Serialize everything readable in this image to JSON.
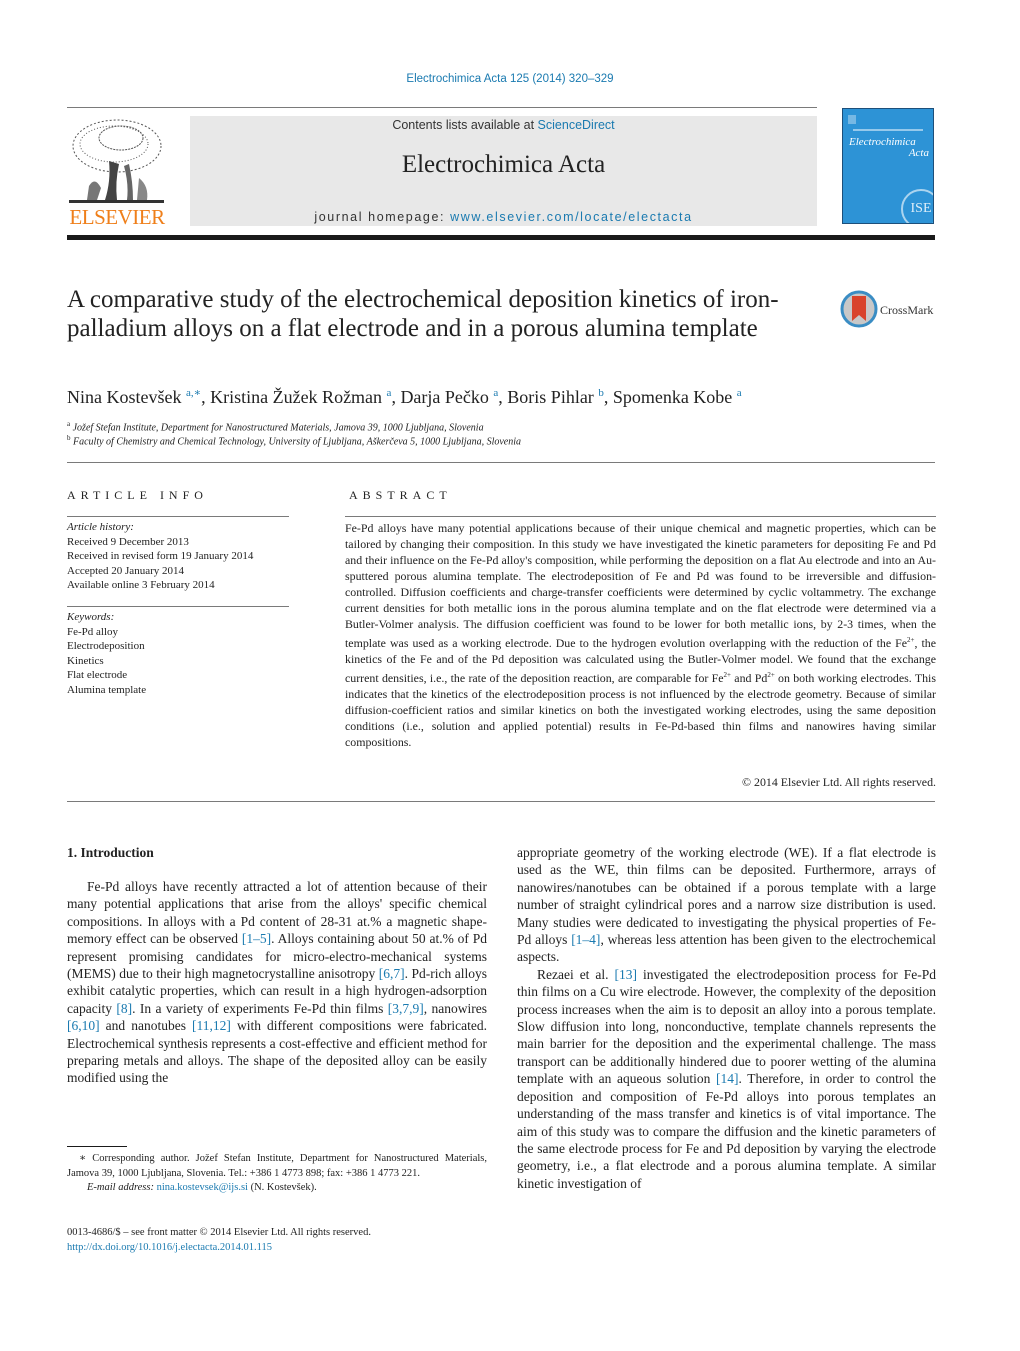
{
  "header": {
    "citation": "Electrochimica Acta 125 (2014) 320–329",
    "contents_prefix": "Contents lists available at ",
    "contents_link": "ScienceDirect",
    "journal_name": "Electrochimica Acta",
    "homepage_prefix": "journal homepage: ",
    "homepage_url": "www.elsevier.com/locate/electacta",
    "publisher_logo_text": "ELSEVIER",
    "cover_title_line1": "Electrochimica",
    "cover_title_line2": "Acta",
    "cover_badge": "ISE",
    "colors": {
      "link": "#1a7ab0",
      "elsevier_orange": "#ef7f1a",
      "cover_blue": "#2d93d6",
      "header_bg": "#e8e8e8"
    }
  },
  "article": {
    "title": "A comparative study of the electrochemical deposition kinetics of iron-palladium alloys on a flat electrode and in a porous alumina template",
    "crossmark_label": "CrossMark",
    "authors": [
      {
        "name": "Nina Kostevšek",
        "sup": "a,∗"
      },
      {
        "name": "Kristina Žužek Rožman",
        "sup": "a"
      },
      {
        "name": "Darja Pečko",
        "sup": "a"
      },
      {
        "name": "Boris Pihlar",
        "sup": "b"
      },
      {
        "name": "Spomenka Kobe",
        "sup": "a"
      }
    ],
    "affiliations": [
      {
        "sup": "a",
        "text": "Jožef Stefan Institute, Department for Nanostructured Materials, Jamova 39, 1000 Ljubljana, Slovenia"
      },
      {
        "sup": "b",
        "text": "Faculty of Chemistry and Chemical Technology, University of Ljubljana, Aškerčeva 5, 1000 Ljubljana, Slovenia"
      }
    ]
  },
  "article_info": {
    "heading": "ARTICLE INFO",
    "history_label": "Article history:",
    "history": [
      "Received 9 December 2013",
      "Received in revised form 19 January 2014",
      "Accepted 20 January 2014",
      "Available online 3 February 2014"
    ],
    "keywords_label": "Keywords:",
    "keywords": [
      "Fe-Pd alloy",
      "Electrodeposition",
      "Kinetics",
      "Flat electrode",
      "Alumina template"
    ]
  },
  "abstract": {
    "heading": "ABSTRACT",
    "part1": "Fe-Pd alloys have many potential applications because of their unique chemical and magnetic properties, which can be tailored by changing their composition. In this study we have investigated the kinetic parameters for depositing Fe and Pd and their influence on the Fe-Pd alloy's composition, while performing the deposition on a flat Au electrode and into an Au-sputtered porous alumina template. The electrodeposition of Fe and Pd was found to be irreversible and diffusion-controlled. Diffusion coefficients and charge-transfer coefficients were determined by cyclic voltammetry. The exchange current densities for both metallic ions in the porous alumina template and on the flat electrode were determined via a Butler-Volmer analysis. The diffusion coefficient was found to be lower for both metallic ions, by 2-3 times, when the template was used as a working electrode. Due to the hydrogen evolution overlapping with the reduction of the Fe",
    "part2": ", the kinetics of the Fe and of the Pd deposition was calculated using the Butler-Volmer model. We found that the exchange current densities, i.e., the rate of the deposition reaction, are comparable for Fe",
    "part3": " and Pd",
    "part4": " on both working electrodes. This indicates that the kinetics of the electrodeposition process is not influenced by the electrode geometry. Because of similar diffusion-coefficient ratios and similar kinetics on both the investigated working electrodes, using the same deposition conditions (i.e., solution and applied potential) results in Fe-Pd-based thin films and nanowires having similar compositions.",
    "charge": "2+",
    "copyright": "© 2014 Elsevier Ltd. All rights reserved."
  },
  "intro": {
    "heading": "1.  Introduction",
    "left": {
      "t1": "Fe-Pd alloys have recently attracted a lot of attention because of their many potential applications that arise from the alloys' specific chemical compositions. In alloys with a Pd content of 28-31 at.% a magnetic shape-memory effect can be observed ",
      "r1": "[1–5]",
      "t2": ". Alloys containing about 50 at.% of Pd represent promising candidates for micro-electro-mechanical systems (MEMS) due to their high magnetocrystalline anisotropy ",
      "r2": "[6,7]",
      "t3": ". Pd-rich alloys exhibit catalytic properties, which can result in a high hydrogen-adsorption capacity ",
      "r3": "[8]",
      "t4": ". In a variety of experiments Fe-Pd thin films ",
      "r4": "[3,7,9]",
      "t5": ", nanowires ",
      "r5": "[6,10]",
      "t6": " and nanotubes ",
      "r6": "[11,12]",
      "t7": " with different compositions were fabricated. Electrochemical synthesis represents a cost-effective and efficient method for preparing metals and alloys. The shape of the deposited alloy can be easily modified using the"
    },
    "right": {
      "p1a": "appropriate geometry of the working electrode (WE). If a flat electrode is used as the WE, thin films can be deposited. Furthermore, arrays of nanowires/nanotubes can be obtained if a porous template with a large number of straight cylindrical pores and a narrow size distribution is used. Many studies were dedicated to investigating the physical properties of Fe-Pd alloys ",
      "r1": "[1–4]",
      "p1b": ", whereas less attention has been given to the electrochemical aspects.",
      "p2a": "Rezaei et al. ",
      "r2": "[13]",
      "p2b": " investigated the electrodeposition process for Fe-Pd thin films on a Cu wire electrode. However, the complexity of the deposition process increases when the aim is to deposit an alloy into a porous template. Slow diffusion into long, nonconductive, template channels represents the main barrier for the deposition and the experimental challenge. The mass transport can be additionally hindered due to poorer wetting of the alumina template with an aqueous solution ",
      "r3": "[14]",
      "p2c": ". Therefore, in order to control the deposition and composition of Fe-Pd alloys into porous templates an understanding of the mass transfer and kinetics is of vital importance. The aim of this study was to compare the diffusion and the kinetic parameters of the same electrode process for Fe and Pd deposition by varying the electrode geometry, i.e., a flat electrode and a porous alumina template. A similar kinetic investigation of"
    }
  },
  "footnote": {
    "star": "∗",
    "text": " Corresponding author. Jožef Stefan Institute, Department for Nanostructured Materials, Jamova 39, 1000 Ljubljana, Slovenia. Tel.: +386 1 4773 898; fax: +386 1 4773 221.",
    "email_label": "E-mail address: ",
    "email": "nina.kostevsek@ijs.si",
    "email_suffix": " (N. Kostevšek)."
  },
  "front_matter": {
    "issn_line": "0013-4686/$ – see front matter © 2014 Elsevier Ltd. All rights reserved.",
    "doi": "http://dx.doi.org/10.1016/j.electacta.2014.01.115"
  }
}
